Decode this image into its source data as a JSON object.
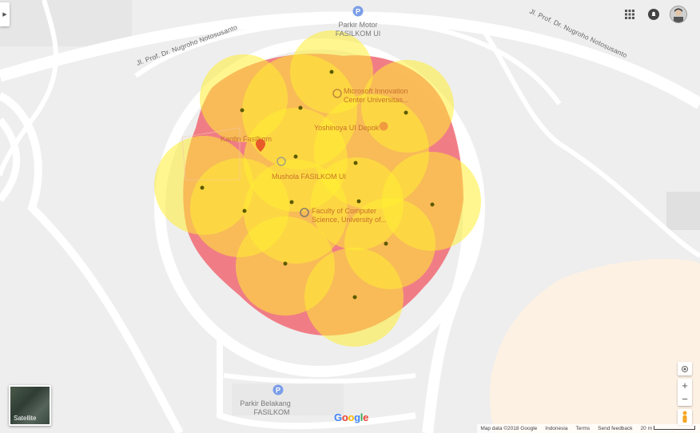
{
  "map": {
    "roads": {
      "north_west": "Jl. Prof. Dr. Nugroho Notosusanto",
      "north_east": "Jl. Prof. Dr. Nugroho Notosusanto"
    },
    "pois": {
      "parkir_motor_line1": "Parkir Motor",
      "parkir_motor_line2": "FASILKOM UI",
      "microsoft_line1": "Microsoft Innovation",
      "microsoft_line2": "Center Universitas...",
      "yoshinoya": "Yoshinoya UI Depok",
      "kantin": "Kantin Fasilkom",
      "mushola": "Mushola FASILKOM UI",
      "faculty_line1": "Faculty of Computer",
      "faculty_line2": "Science, University of...",
      "parkir_belakang_line1": "Parkir Belakang",
      "parkir_belakang_line2": "FASILKOM"
    },
    "colors": {
      "coverage_red": "#f0707a",
      "circle_yellow": "#ffee33",
      "dot": "#6b5a00",
      "road": "#ffffff",
      "background": "#eeeeee",
      "sandy_area": "#fdf0e3"
    }
  },
  "ui": {
    "collapse_icon": "triangle-right-icon",
    "top_right": [
      "apps-grid-icon",
      "notifications-icon",
      "account-avatar"
    ],
    "satellite_label": "Satellite",
    "controls": [
      "my-location-icon",
      "zoom-in",
      "zoom-out",
      "pegman-icon"
    ],
    "zoom_in": "+",
    "zoom_out": "−",
    "google_logo": {
      "letters": [
        "G",
        "o",
        "o",
        "g",
        "l",
        "e"
      ],
      "colors": [
        "#4285F4",
        "#EA4335",
        "#FBBC05",
        "#4285F4",
        "#34A853",
        "#EA4335"
      ]
    }
  },
  "footer": {
    "map_data": "Map data ©2018 Google",
    "region": "Indonesia",
    "terms": "Terms",
    "feedback": "Send feedback",
    "scale": "20 m"
  }
}
